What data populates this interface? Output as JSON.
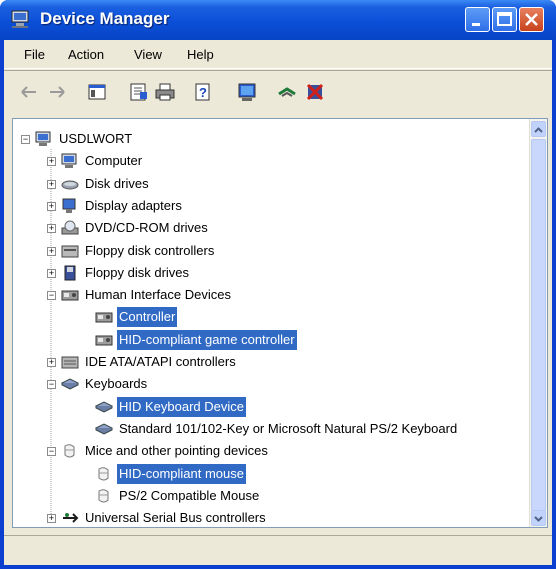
{
  "window": {
    "title": "Device Manager"
  },
  "menu": [
    "File",
    "Action",
    "View",
    "Help"
  ],
  "toolbar": [
    {
      "icon": "back-arrow-icon"
    },
    {
      "icon": "forward-arrow-icon"
    },
    {
      "icon": "show-hide-console-tree-icon"
    },
    {
      "icon": "properties-icon"
    },
    {
      "icon": "print-icon"
    },
    {
      "icon": "help-icon"
    },
    {
      "icon": "scan-hardware-icon"
    },
    {
      "icon": "update-driver-icon"
    },
    {
      "icon": "uninstall-icon"
    }
  ],
  "tree": [
    {
      "label": "USDLWORT",
      "level": 0,
      "expander": "−",
      "icon": "computer-icon",
      "selected": false
    },
    {
      "label": "Computer",
      "level": 1,
      "expander": "+",
      "icon": "computer-icon",
      "selected": false
    },
    {
      "label": "Disk drives",
      "level": 1,
      "expander": "+",
      "icon": "disk-drive-icon",
      "selected": false
    },
    {
      "label": "Display adapters",
      "level": 1,
      "expander": "+",
      "icon": "display-adapter-icon",
      "selected": false
    },
    {
      "label": "DVD/CD-ROM drives",
      "level": 1,
      "expander": "+",
      "icon": "dvd-drive-icon",
      "selected": false
    },
    {
      "label": "Floppy disk controllers",
      "level": 1,
      "expander": "+",
      "icon": "floppy-controller-icon",
      "selected": false
    },
    {
      "label": "Floppy disk drives",
      "level": 1,
      "expander": "+",
      "icon": "floppy-drive-icon",
      "selected": false
    },
    {
      "label": "Human Interface Devices",
      "level": 1,
      "expander": "−",
      "icon": "hid-icon",
      "selected": false
    },
    {
      "label": "Controller",
      "level": 2,
      "expander": "",
      "icon": "hid-icon",
      "selected": true
    },
    {
      "label": "HID-compliant game controller",
      "level": 2,
      "expander": "",
      "icon": "hid-icon",
      "selected": true
    },
    {
      "label": "IDE ATA/ATAPI controllers",
      "level": 1,
      "expander": "+",
      "icon": "ide-controller-icon",
      "selected": false
    },
    {
      "label": "Keyboards",
      "level": 1,
      "expander": "−",
      "icon": "keyboard-icon",
      "selected": false
    },
    {
      "label": "HID Keyboard Device",
      "level": 2,
      "expander": "",
      "icon": "keyboard-icon",
      "selected": true
    },
    {
      "label": "Standard 101/102-Key or Microsoft Natural PS/2 Keyboard",
      "level": 2,
      "expander": "",
      "icon": "keyboard-icon",
      "selected": false
    },
    {
      "label": "Mice and other pointing devices",
      "level": 1,
      "expander": "−",
      "icon": "mouse-icon",
      "selected": false
    },
    {
      "label": "HID-compliant mouse",
      "level": 2,
      "expander": "",
      "icon": "mouse-icon",
      "selected": true
    },
    {
      "label": "PS/2 Compatible Mouse",
      "level": 2,
      "expander": "",
      "icon": "mouse-icon",
      "selected": false
    },
    {
      "label": "Universal Serial Bus controllers",
      "level": 1,
      "expander": "+",
      "icon": "usb-icon",
      "selected": false
    }
  ],
  "colors": {
    "titlebar": "#0b4fd8",
    "selection": "#316ac5",
    "chrome": "#ece9d8"
  }
}
